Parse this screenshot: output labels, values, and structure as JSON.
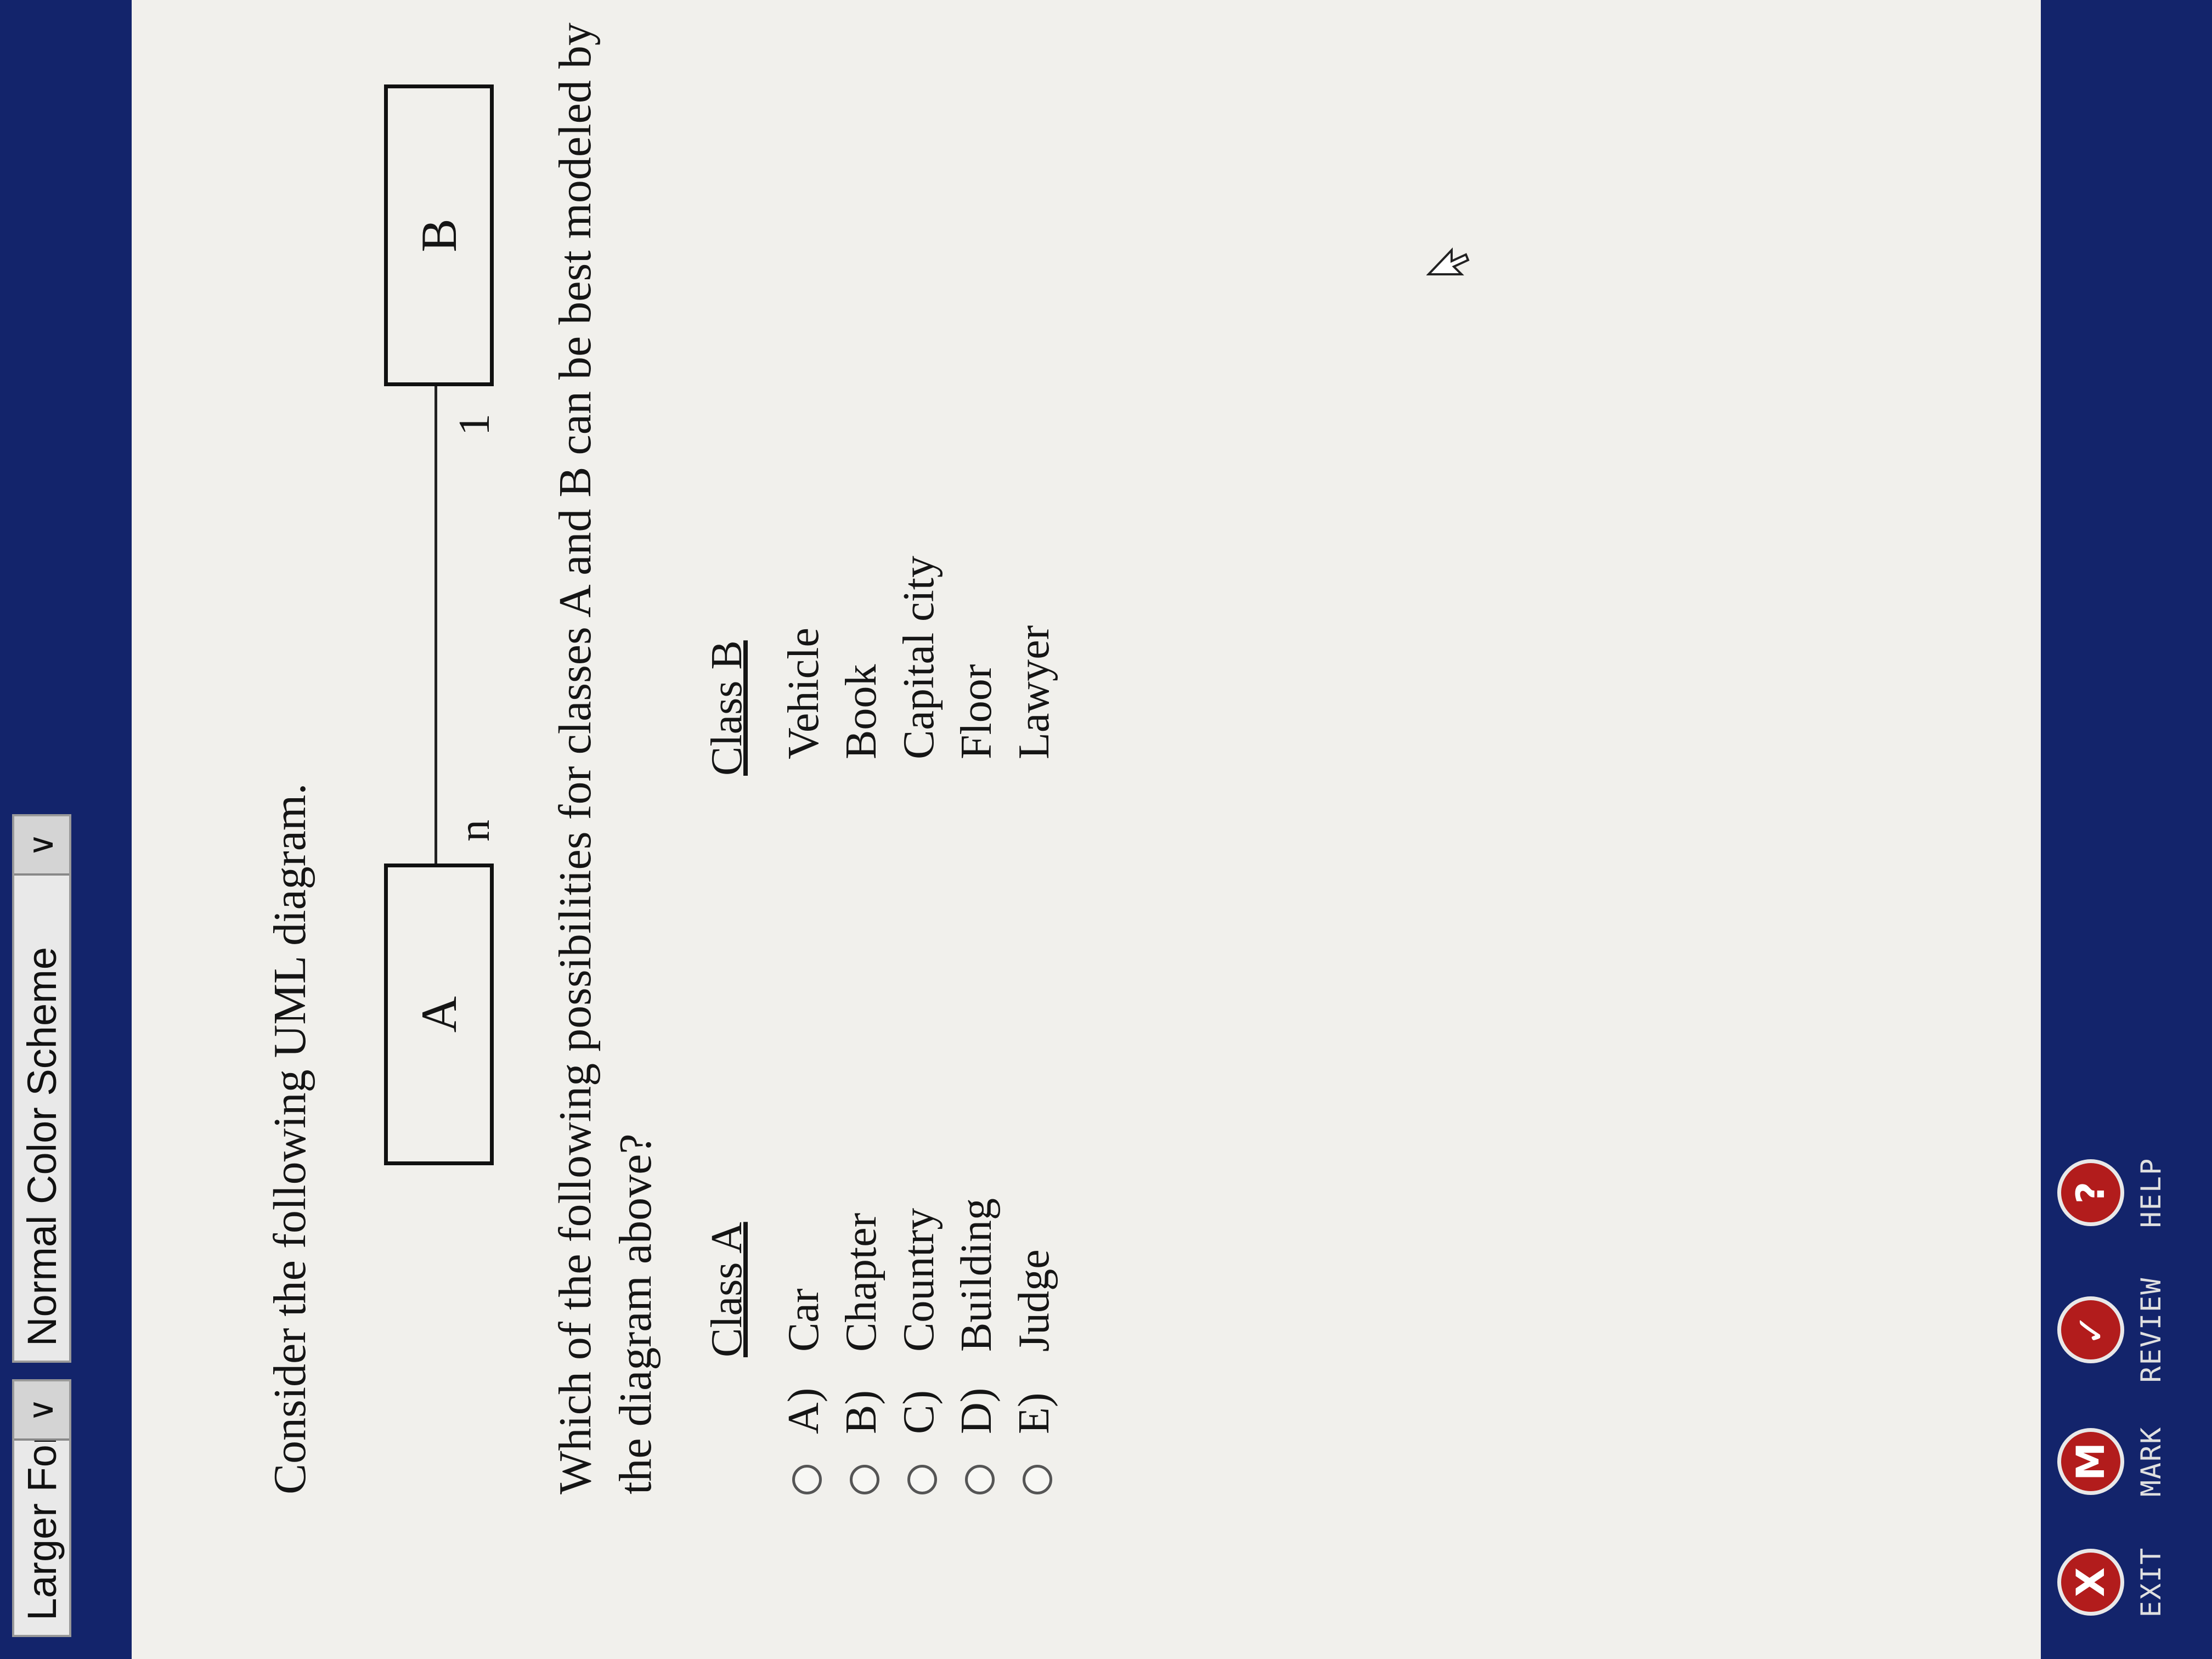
{
  "toolbar": {
    "font_select": "Larger Font",
    "color_select": "Normal Color Scheme"
  },
  "question": {
    "intro": "Consider the following UML diagram.",
    "diagram": {
      "class_a": "A",
      "class_b": "B",
      "mult_a": "n",
      "mult_b": "1"
    },
    "prompt_line1": "Which of the following possibilities for classes A and B can be best modeled by",
    "prompt_line2": "the diagram above?",
    "col_a_header": "Class A",
    "col_b_header": "Class B",
    "options": [
      {
        "letter": "A)",
        "a": "Car",
        "b": "Vehicle"
      },
      {
        "letter": "B)",
        "a": "Chapter",
        "b": "Book"
      },
      {
        "letter": "C)",
        "a": "Country",
        "b": "Capital city"
      },
      {
        "letter": "D)",
        "a": "Building",
        "b": "Floor"
      },
      {
        "letter": "E)",
        "a": "Judge",
        "b": "Lawyer"
      }
    ]
  },
  "footer": {
    "exit_glyph": "X",
    "exit_label": "EXIT",
    "mark_glyph": "M",
    "mark_label": "MARK",
    "review_glyph": "✓",
    "review_label": "REVIEW",
    "help_glyph": "?",
    "help_label": "HELP"
  },
  "colors": {
    "toolbar_bg": "#13246b",
    "content_bg": "#f1f0ec",
    "button_red": "#b21c1c"
  }
}
